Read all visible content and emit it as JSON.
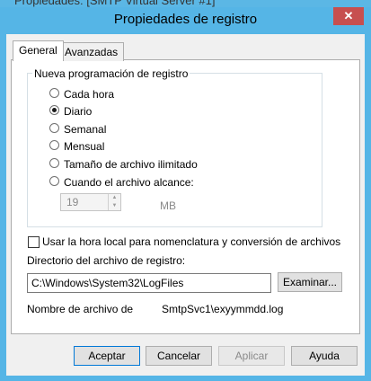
{
  "background_window": {
    "title_fragment": "Propiedades: [SMTP Virtual Server #1]"
  },
  "dialog": {
    "title": "Propiedades de registro",
    "close_glyph": "✕"
  },
  "tabs": [
    {
      "label": "General",
      "active": true
    },
    {
      "label": "Avanzadas",
      "active": false
    }
  ],
  "schedule": {
    "group_label": "Nueva programación de registro",
    "options": [
      {
        "label": "Cada hora",
        "checked": false
      },
      {
        "label": "Diario",
        "checked": true
      },
      {
        "label": "Semanal",
        "checked": false
      },
      {
        "label": "Mensual",
        "checked": false
      },
      {
        "label": "Tamaño de archivo ilimitado",
        "checked": false
      },
      {
        "label": "Cuando el archivo alcance:",
        "checked": false
      }
    ],
    "size_value": "19",
    "size_unit": "MB"
  },
  "local_time": {
    "label": "Usar la hora local para nomenclatura y conversión de archivos",
    "checked": false
  },
  "directory": {
    "label": "Directorio del archivo de registro:",
    "value": "C:\\Windows\\System32\\LogFiles",
    "browse_label": "Examinar..."
  },
  "filename": {
    "label": "Nombre de archivo de",
    "value": "SmtpSvc1\\exyymmdd.log"
  },
  "buttons": {
    "ok": "Aceptar",
    "cancel": "Cancelar",
    "apply": "Aplicar",
    "help": "Ayuda"
  },
  "colors": {
    "frame": "#55b5e6",
    "close": "#c74f4f",
    "focus": "#0078d7"
  }
}
